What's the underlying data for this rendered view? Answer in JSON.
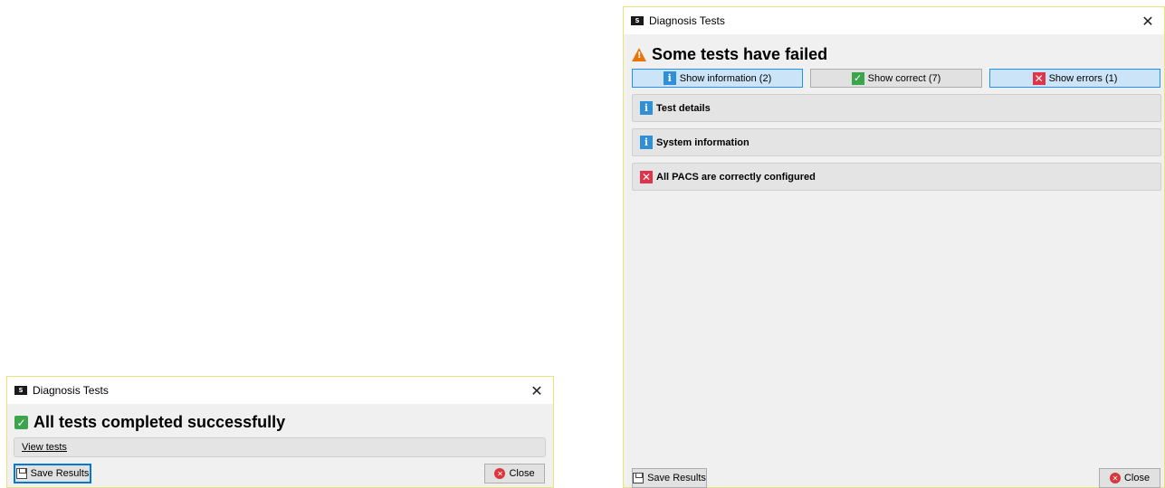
{
  "small_dialog": {
    "title": "Diagnosis Tests",
    "app_icon_text": "S",
    "close_glyph": "✕",
    "heading": "All tests completed successfully",
    "heading_icon": "check-icon",
    "view_tests_link": "View tests",
    "save_button": "Save Results",
    "close_button": "Close"
  },
  "large_dialog": {
    "title": "Diagnosis Tests",
    "app_icon_text": "S",
    "close_glyph": "✕",
    "heading": "Some tests have failed",
    "heading_icon": "warning-icon",
    "filters": {
      "info": "Show information (2)",
      "correct": "Show correct (7)",
      "errors": "Show errors (1)"
    },
    "sections": [
      {
        "label": "Test details",
        "icon": "info-icon"
      },
      {
        "label": "System information",
        "icon": "info-icon"
      },
      {
        "label": "All PACS are correctly configured",
        "icon": "error-icon"
      }
    ],
    "save_button": "Save Results",
    "close_button": "Close"
  },
  "colors": {
    "accent": "#0078d7",
    "success": "#3aa54a",
    "warning": "#e8740c",
    "error": "#e0344a",
    "info": "#2f8fd8"
  }
}
